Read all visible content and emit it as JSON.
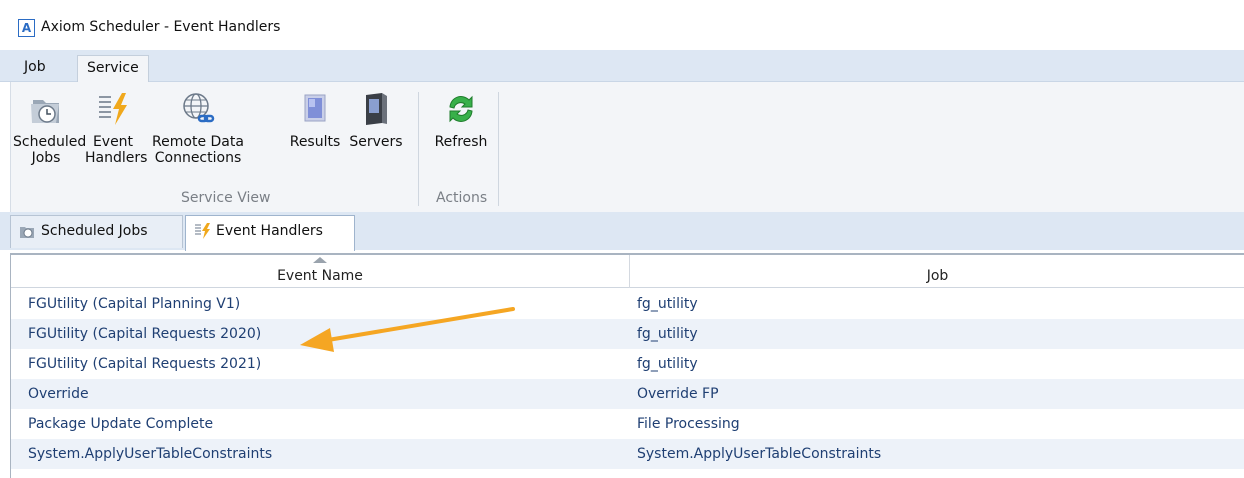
{
  "window": {
    "app_icon_letter": "A",
    "title": "Axiom Scheduler - Event Handlers"
  },
  "menu": {
    "tabs": [
      "Job",
      "Service"
    ],
    "active": "Service"
  },
  "ribbon": {
    "buttons": [
      {
        "label": "Scheduled\nJobs",
        "icon": "scheduled-jobs-icon"
      },
      {
        "label": "Event\nHandlers",
        "icon": "event-handlers-icon"
      },
      {
        "label": "Remote Data\nConnections",
        "icon": "globe-icon"
      },
      {
        "label": "Results",
        "icon": "results-icon"
      },
      {
        "label": "Servers",
        "icon": "server-icon"
      },
      {
        "label": "Refresh",
        "icon": "refresh-icon"
      }
    ],
    "groups": [
      "Service View",
      "Actions"
    ]
  },
  "doc_tabs": [
    {
      "label": "Scheduled Jobs",
      "active": false
    },
    {
      "label": "Event Handlers",
      "active": true
    }
  ],
  "grid": {
    "columns": [
      "Event Name",
      "Job"
    ],
    "sorted_column": "Event Name",
    "rows": [
      {
        "event": "FGUtility (Capital Planning V1)",
        "job": "fg_utility"
      },
      {
        "event": "FGUtility (Capital Requests 2020)",
        "job": "fg_utility"
      },
      {
        "event": "FGUtility (Capital Requests 2021)",
        "job": "fg_utility"
      },
      {
        "event": "Override",
        "job": "Override FP"
      },
      {
        "event": "Package Update Complete",
        "job": "File Processing"
      },
      {
        "event": "System.ApplyUserTableConstraints",
        "job": "System.ApplyUserTableConstraints"
      }
    ]
  },
  "colors": {
    "accent": "#2b6cc4",
    "annotation_arrow": "#f5a623",
    "row_text": "#1f3f73",
    "alt_row": "#edf2f9"
  }
}
